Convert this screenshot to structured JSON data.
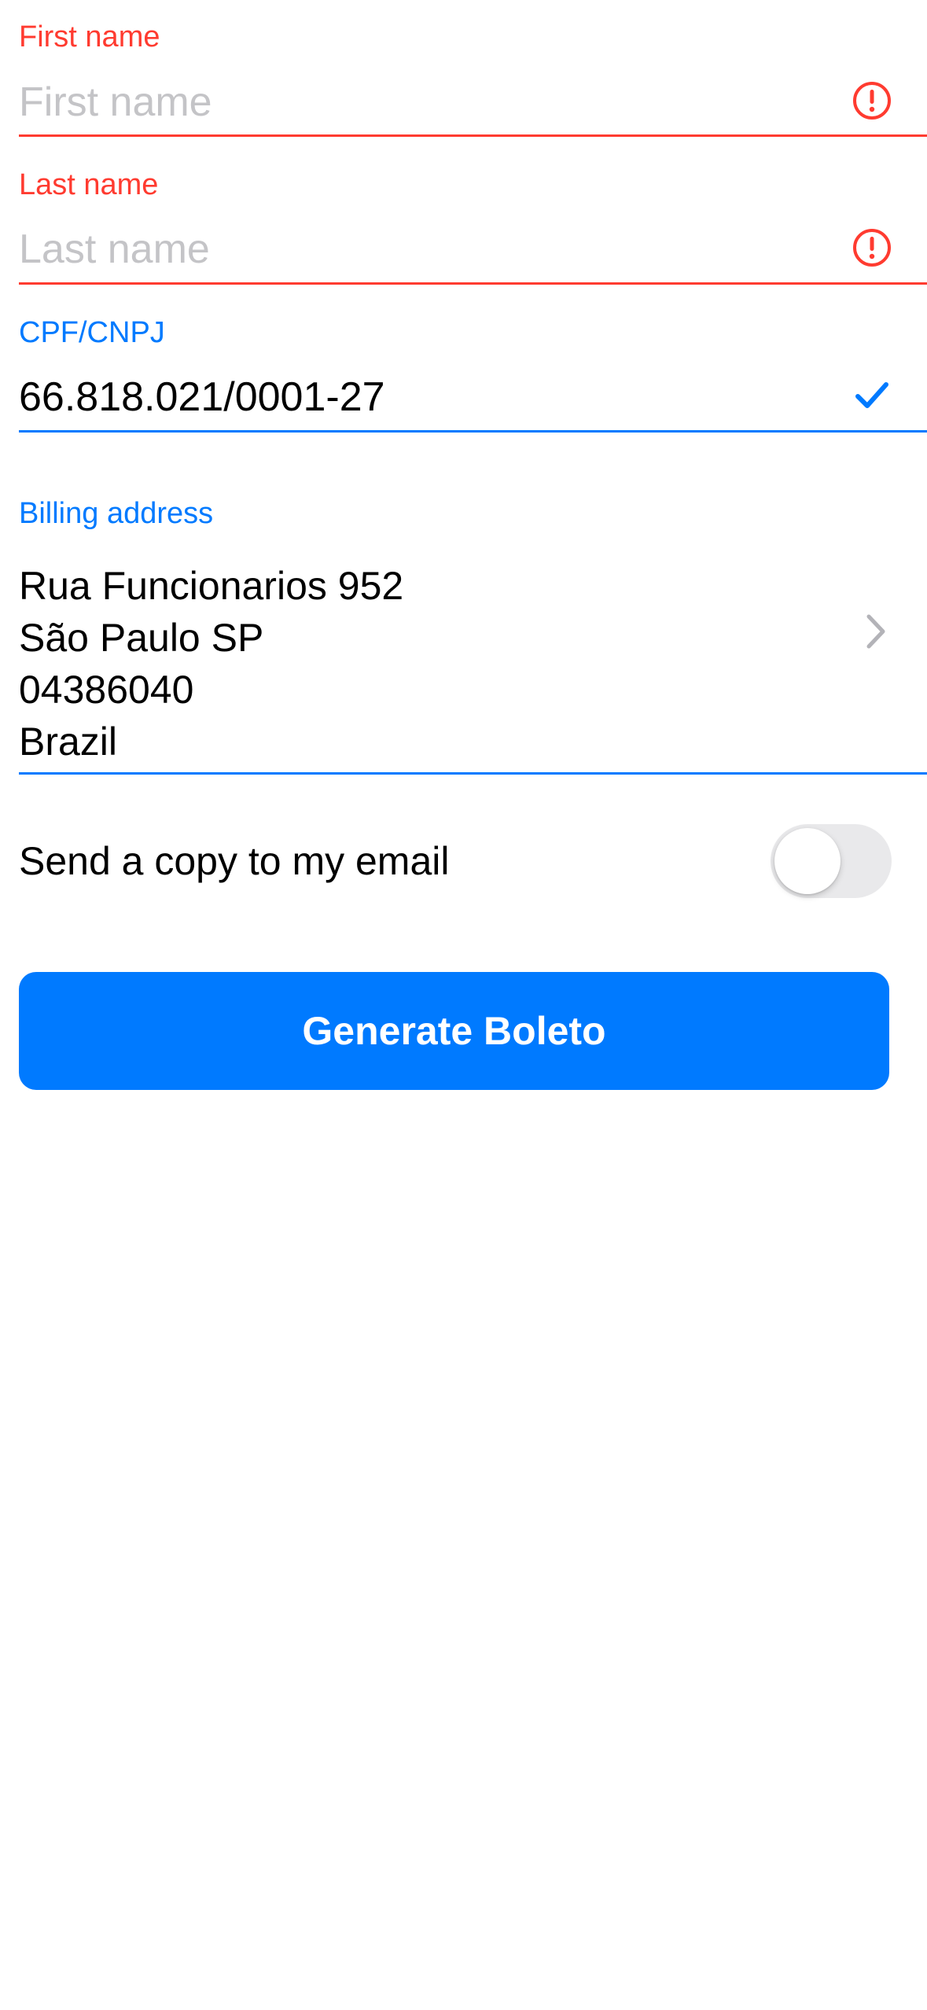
{
  "colors": {
    "error": "#ff3b30",
    "accent": "#007aff",
    "placeholder": "#c4c4c7",
    "toggle_off": "#e9e9eb",
    "chevron": "#b3b3b8"
  },
  "form": {
    "first_name": {
      "label": "First name",
      "placeholder": "First name",
      "value": "",
      "state": "error",
      "icon": "exclamation-circle-icon"
    },
    "last_name": {
      "label": "Last name",
      "placeholder": "Last name",
      "value": "",
      "state": "error",
      "icon": "exclamation-circle-icon"
    },
    "cpf_cnpj": {
      "label": "CPF/CNPJ",
      "value": "66.818.021/0001-27",
      "state": "valid",
      "icon": "checkmark-icon"
    },
    "billing_address": {
      "label": "Billing address",
      "lines": [
        "Rua Funcionarios 952",
        "São Paulo SP",
        "04386040",
        "Brazil"
      ],
      "icon": "chevron-right-icon"
    },
    "send_copy": {
      "label": "Send a copy to my email",
      "enabled": false
    },
    "submit": {
      "label": "Generate Boleto"
    }
  }
}
